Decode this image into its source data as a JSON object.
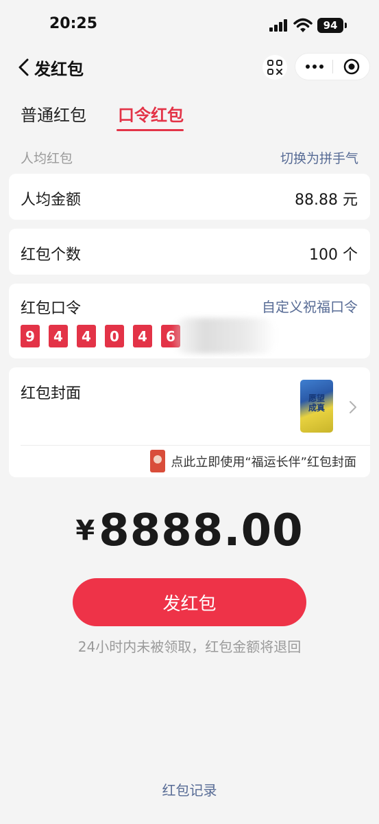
{
  "status_bar": {
    "time": "20:25",
    "battery": "94",
    "icons": [
      "signal-icon",
      "wifi-icon",
      "battery-icon"
    ]
  },
  "nav": {
    "title": "发红包",
    "icons": [
      "back-icon",
      "qr-scan-icon",
      "more-icon",
      "close-icon"
    ]
  },
  "tabs": [
    {
      "label": "普通红包",
      "active": false
    },
    {
      "label": "口令红包",
      "active": true
    }
  ],
  "section": {
    "label": "人均红包",
    "switch_link": "切换为拼手气"
  },
  "avg_amount": {
    "label": "人均金额",
    "value": "88.88 元"
  },
  "count": {
    "label": "红包个数",
    "value": "100 个"
  },
  "command": {
    "label": "红包口令",
    "custom_link": "自定义祝福口令",
    "digits": [
      "9",
      "4",
      "4",
      "0",
      "4",
      "6"
    ]
  },
  "cover": {
    "label": "红包封面",
    "thumb_text": "愿望成真",
    "promo_text": "点此立即使用“福运长伴”红包封面"
  },
  "total": {
    "currency": "¥",
    "amount": "8888.00"
  },
  "send_button": "发红包",
  "refund_note": "24小时内未被领取，红包金额将退回",
  "records_link": "红包记录",
  "colors": {
    "accent": "#e33347",
    "button": "#ee3348",
    "link": "#576b95",
    "background": "#f4f4f4"
  }
}
